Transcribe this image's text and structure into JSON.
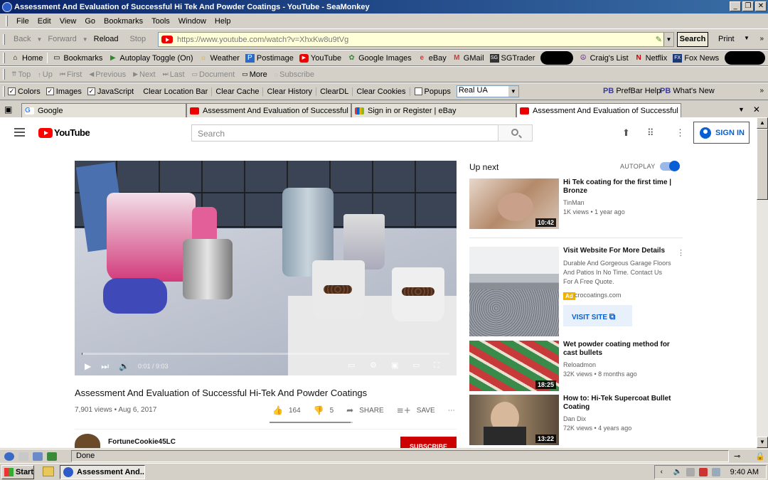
{
  "window": {
    "title": "Assessment And Evaluation of Successful Hi Tek And Powder Coatings - YouTube - SeaMonkey",
    "buttons": {
      "minimize": "_",
      "restore": "❐",
      "close": "✕"
    }
  },
  "menu": [
    "File",
    "Edit",
    "View",
    "Go",
    "Bookmarks",
    "Tools",
    "Window",
    "Help"
  ],
  "nav": {
    "back": "Back",
    "forward": "Forward",
    "reload": "Reload",
    "stop": "Stop",
    "url": "https://www.youtube.com/watch?v=XhxKw8u9tVg",
    "search": "Search",
    "print": "Print"
  },
  "bookmarks": {
    "items": [
      {
        "label": "Home",
        "icon": "home-icon"
      },
      {
        "label": "Bookmarks",
        "icon": "bookmarks-icon"
      },
      {
        "label": "Autoplay Toggle (On)",
        "icon": "play-icon"
      },
      {
        "label": "Weather",
        "icon": "weather-icon"
      },
      {
        "label": "Postimage",
        "icon": "postimage-icon"
      },
      {
        "label": "YouTube",
        "icon": "youtube-icon"
      },
      {
        "label": "Google Images",
        "icon": "google-icon"
      },
      {
        "label": "eBay",
        "icon": "ebay-icon"
      },
      {
        "label": "GMail",
        "icon": "gmail-icon"
      },
      {
        "label": "SGTrader",
        "icon": "sgtrader-icon"
      },
      {
        "label": "Craig's List",
        "icon": "peace-icon"
      },
      {
        "label": "Netflix",
        "icon": "netflix-icon"
      },
      {
        "label": "Fox News",
        "icon": "foxnews-icon"
      }
    ]
  },
  "sitenav": {
    "top": "Top",
    "up": "Up",
    "first": "First",
    "previous": "Previous",
    "next": "Next",
    "last": "Last",
    "document": "Document",
    "more": "More",
    "subscribe": "Subscribe"
  },
  "prefbar": {
    "colors": "Colors",
    "images": "Images",
    "javascript": "JavaScript",
    "clear_location": "Clear Location Bar",
    "clear_cache": "Clear Cache",
    "clear_history": "Clear History",
    "cleardl": "ClearDL",
    "clear_cookies": "Clear Cookies",
    "popups": "Popups",
    "ua": "Real UA",
    "pb_badge": "PB",
    "help": "PrefBar Help",
    "whats_new": "What's New",
    "check": "✓"
  },
  "tabs": [
    {
      "label": "Google",
      "fav": "G"
    },
    {
      "label": "Assessment And Evaluation of Successful H..."
    },
    {
      "label": "Sign in or Register | eBay"
    },
    {
      "label": "Assessment And Evaluation of Successful H..."
    }
  ],
  "youtube": {
    "logo": "YouTube",
    "search_placeholder": "Search",
    "sign_in": "SIGN IN",
    "video": {
      "time": "0:01 / 9:03",
      "title": "Assessment And Evaluation of Successful Hi-Tek And Powder Coatings",
      "views_date": "7,901 views • Aug 6, 2017",
      "likes": "164",
      "dislikes": "5",
      "share": "SHARE",
      "save": "SAVE",
      "progress": 0.002,
      "channel": "FortuneCookie45LC",
      "subscribe": "SUBSCRIBE"
    },
    "up_next": "Up next",
    "autoplay": "AUTOPLAY",
    "recs": [
      {
        "title": "Hi Tek coating for the first time | Bronze",
        "channel": "TinMan",
        "meta": "1K views • 1 year ago",
        "duration": "10:42"
      },
      {
        "title": "Visit Website For More Details",
        "desc": "Durable And Gorgeous Garage Floors And Patios In No Time. Contact Us For A Free Quote.",
        "ad": "Ad",
        "domain": "crocoatings.com",
        "cta": "VISIT SITE"
      },
      {
        "title": "Wet powder coating method for cast bullets",
        "channel": "Reloadmon",
        "meta": "32K views • 8 months ago",
        "duration": "18:25"
      },
      {
        "title": "How to: Hi-Tek Supercoat Bullet Coating",
        "channel": "Dan Dix",
        "meta": "72K views • 4 years ago",
        "duration": "13:22"
      }
    ]
  },
  "status": {
    "text": "Done"
  },
  "taskbar": {
    "start": "Start",
    "task": "Assessment And...",
    "clock": "9:40 AM"
  },
  "colors": {
    "youtube_red": "#ff0000",
    "link_blue": "#065fd4",
    "title_bar": "#0a246a"
  }
}
